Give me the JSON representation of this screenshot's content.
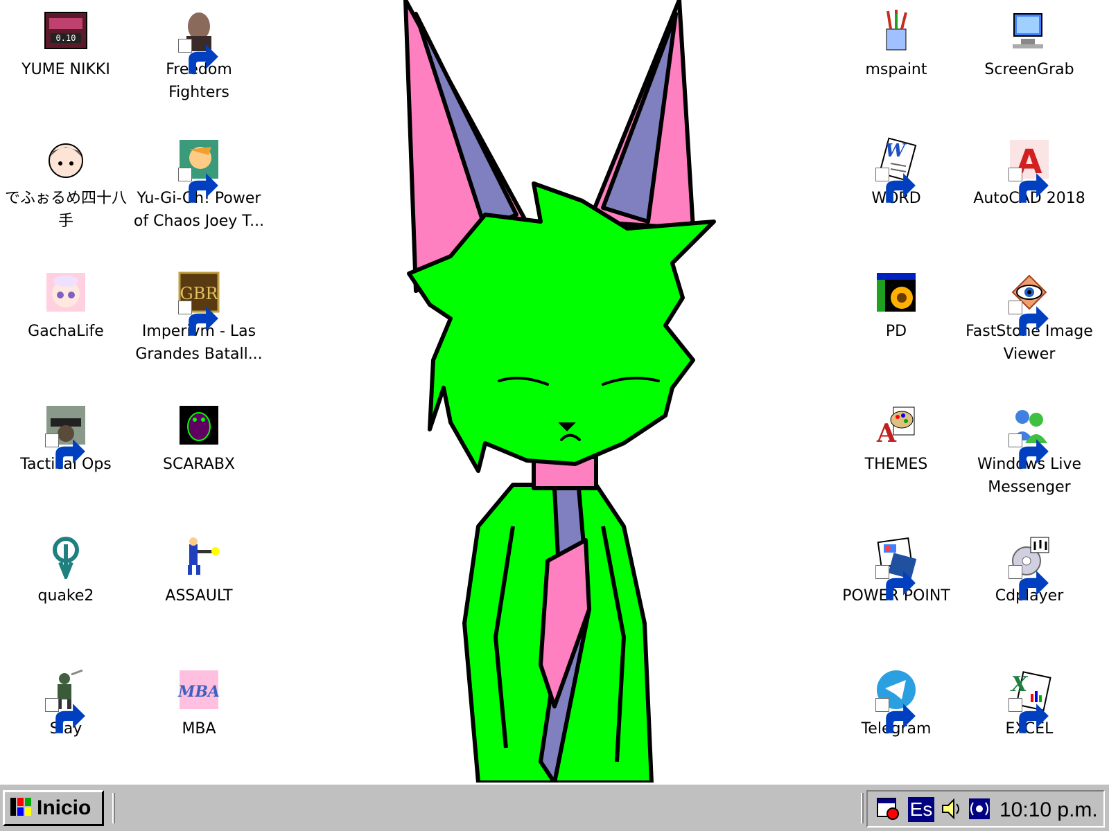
{
  "desktop": {
    "icons_left": [
      {
        "label": "YUME NIKKI",
        "icon": "yume-nikki-icon",
        "shortcut": false
      },
      {
        "label": "Freedom Fighters",
        "icon": "freedom-fighters-icon",
        "shortcut": true
      },
      {
        "label": "でふぉるめ四十八手",
        "icon": "anime-face-icon",
        "shortcut": false
      },
      {
        "label": "Yu-Gi-Oh! Power of Chaos Joey T...",
        "icon": "yugioh-icon",
        "shortcut": true
      },
      {
        "label": "GachaLife",
        "icon": "gachalife-icon",
        "shortcut": false
      },
      {
        "label": "Imperivm - Las Grandes Batall...",
        "icon": "imperivm-icon",
        "shortcut": true
      },
      {
        "label": "Tactical Ops",
        "icon": "tactical-ops-icon",
        "shortcut": true
      },
      {
        "label": "SCARABX",
        "icon": "scarab-icon",
        "shortcut": false
      },
      {
        "label": "quake2",
        "icon": "quake-icon",
        "shortcut": false
      },
      {
        "label": "ASSAULT",
        "icon": "assault-soldier-icon",
        "shortcut": false
      },
      {
        "label": "Slay",
        "icon": "slay-knight-icon",
        "shortcut": true
      },
      {
        "label": "MBA",
        "icon": "mba-logo-icon",
        "shortcut": false
      }
    ],
    "icons_right": [
      {
        "label": "mspaint",
        "icon": "paint-brushes-icon",
        "shortcut": false
      },
      {
        "label": "ScreenGrab",
        "icon": "screengrab-computer-icon",
        "shortcut": false
      },
      {
        "label": "WORD",
        "icon": "word-document-icon",
        "shortcut": true
      },
      {
        "label": "AutoCAD 2018",
        "icon": "autocad-icon",
        "shortcut": true
      },
      {
        "label": "PD",
        "icon": "sunflower-icon",
        "shortcut": false
      },
      {
        "label": "FastStone Image Viewer",
        "icon": "faststone-eye-icon",
        "shortcut": true
      },
      {
        "label": "THEMES",
        "icon": "themes-palette-icon",
        "shortcut": false
      },
      {
        "label": "Windows Live Messenger",
        "icon": "messenger-buddies-icon",
        "shortcut": true
      },
      {
        "label": "POWER POINT",
        "icon": "powerpoint-icon",
        "shortcut": true
      },
      {
        "label": "Cdplayer",
        "icon": "cd-player-icon",
        "shortcut": true
      },
      {
        "label": "Telegram",
        "icon": "telegram-icon",
        "shortcut": true
      },
      {
        "label": "EXCEL",
        "icon": "excel-icon",
        "shortcut": true
      }
    ]
  },
  "taskbar": {
    "start_label": "Inicio",
    "language": "Es",
    "clock": "10:10 p.m.",
    "tray_icons": [
      "scheduler-icon",
      "volume-icon",
      "network-icon"
    ]
  },
  "colors": {
    "wallpaper_bg": "#ffffff",
    "character_body": "#00ff00",
    "ear_pink": "#ff80c0",
    "ear_purple": "#8080c0",
    "taskbar": "#c0c0c0"
  }
}
